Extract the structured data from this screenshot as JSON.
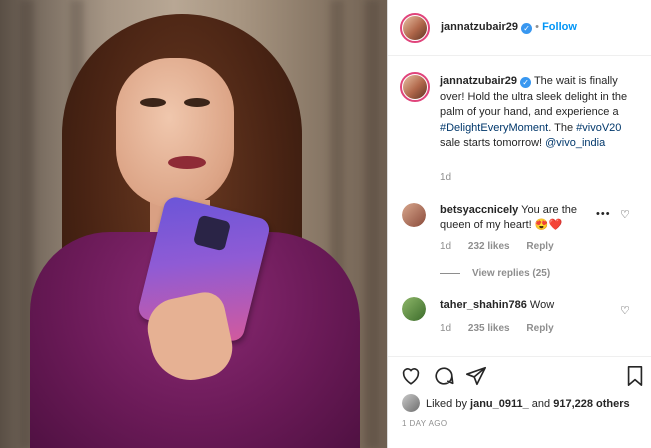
{
  "post": {
    "username": "jannatzubair29",
    "follow_separator": "•",
    "follow_label": "Follow",
    "caption_part1": "The wait is finally over! Hold the ultra sleek delight in the palm of your hand, and experience a ",
    "hashtag1": "#DelightEveryMoment",
    "caption_part2": ". The ",
    "hashtag2": "#vivoV20",
    "caption_part3": " sale starts tomorrow! ",
    "mention": "@vivo_india",
    "time": "1d"
  },
  "comments": [
    {
      "username": "betsyaccnicely",
      "text": "You are the queen of my heart!",
      "emoji": "😍❤️",
      "time": "1d",
      "likes": "232 likes",
      "reply": "Reply",
      "view_replies": "View replies (25)",
      "more": "•••"
    },
    {
      "username": "taher_shahin786",
      "text": "Wow",
      "time": "1d",
      "likes": "235 likes",
      "reply": "Reply"
    }
  ],
  "actions": {
    "like_icon": "heart-icon",
    "comment_icon": "comment-icon",
    "share_icon": "share-icon",
    "save_icon": "bookmark-icon"
  },
  "likes_line": {
    "prefix": "Liked by ",
    "user": "janu_0911_",
    "middle": " and ",
    "count": "917,228 others"
  },
  "date": "1 DAY AGO",
  "colors": {
    "link_blue": "#0095f6",
    "verified": "#3897f0",
    "dress": "#6a1a57"
  }
}
